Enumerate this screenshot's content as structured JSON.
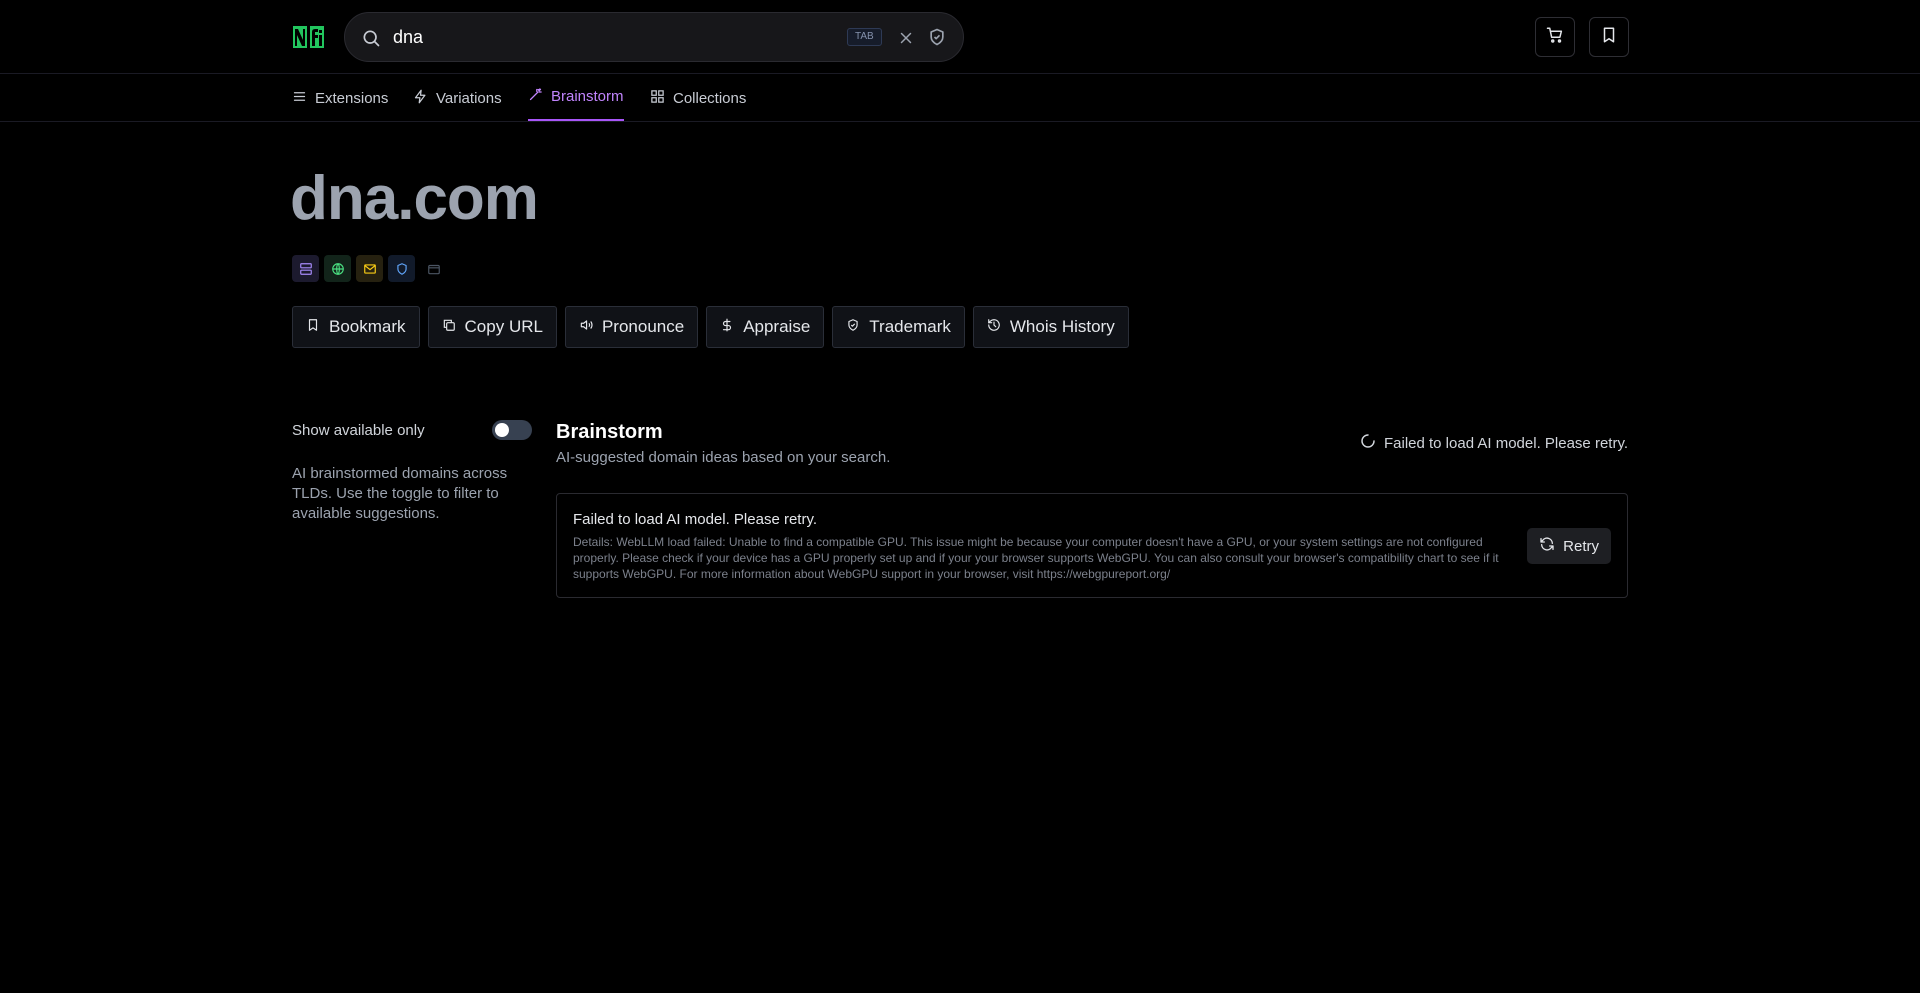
{
  "header": {
    "logo_text": "Nfi",
    "search": {
      "value": "dna",
      "tab_hint": "TAB"
    },
    "icons": [
      "search-icon",
      "close-icon",
      "shield-icon",
      "cart-icon",
      "bookmark-icon"
    ]
  },
  "nav": {
    "tabs": [
      {
        "label": "Extensions",
        "icon": "menu-icon"
      },
      {
        "label": "Variations",
        "icon": "bolt-icon"
      },
      {
        "label": "Brainstorm",
        "icon": "wand-icon",
        "active": true
      },
      {
        "label": "Collections",
        "icon": "grid-icon"
      }
    ]
  },
  "domain": {
    "name": "dna.com"
  },
  "status_chips": [
    {
      "icon": "server-icon",
      "color": "#a78bfa"
    },
    {
      "icon": "globe-icon",
      "color": "#4ade80"
    },
    {
      "icon": "mail-icon",
      "color": "#facc15"
    },
    {
      "icon": "shield-icon",
      "color": "#60a5fa"
    },
    {
      "icon": "wallet-icon",
      "color": "#4b5563"
    }
  ],
  "actions": [
    {
      "label": "Bookmark",
      "icon": "bookmark-icon"
    },
    {
      "label": "Copy URL",
      "icon": "copy-icon"
    },
    {
      "label": "Pronounce",
      "icon": "speaker-icon"
    },
    {
      "label": "Appraise",
      "icon": "dollar-icon"
    },
    {
      "label": "Trademark",
      "icon": "shield-check-icon"
    },
    {
      "label": "Whois History",
      "icon": "history-icon"
    }
  ],
  "sidebar": {
    "toggle_label": "Show available only",
    "toggle_on": false,
    "description": "AI brainstormed domains across TLDs. Use the toggle to filter to available suggestions."
  },
  "brainstorm": {
    "title": "Brainstorm",
    "subtitle": "AI-suggested domain ideas based on your search.",
    "status": "Failed to load AI model. Please retry.",
    "error": {
      "title": "Failed to load AI model. Please retry.",
      "details": "Details: WebLLM load failed: Unable to find a compatible GPU. This issue might be because your computer doesn't have a GPU, or your system settings are not configured properly. Please check if your device has a GPU properly set up and if your your browser supports WebGPU. You can also consult your browser's compatibility chart to see if it supports WebGPU. For more information about WebGPU support in your browser, visit https://webgpureport.org/",
      "retry_label": "Retry"
    }
  },
  "colors": {
    "accent": "#a855f7",
    "logo_green": "#22c55e"
  }
}
